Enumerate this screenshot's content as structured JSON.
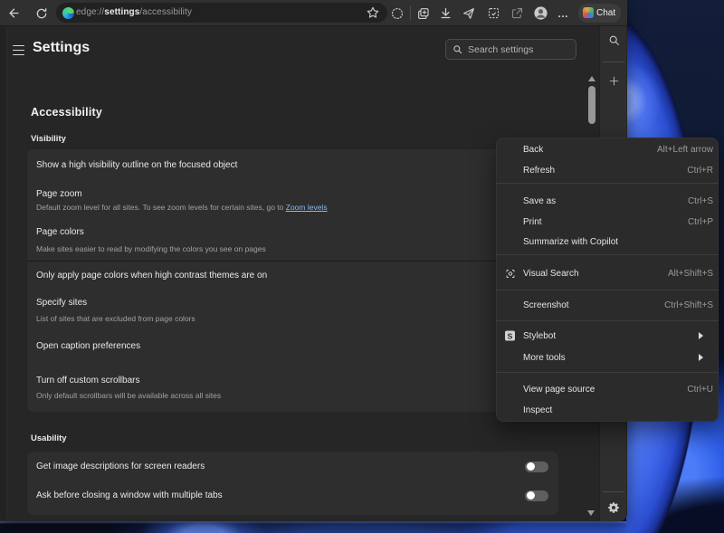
{
  "browser": {
    "url": {
      "scheme": "edge://",
      "highlight": "settings",
      "path": "/accessibility"
    },
    "toolbar_icons": [
      "back",
      "refresh",
      "favorite-star",
      "browser-essentials",
      "collections",
      "downloads",
      "send",
      "web-capture",
      "share",
      "profile-avatar",
      "more-options"
    ],
    "chat_button_label": "Chat"
  },
  "sidebar_rail_icons": [
    "search",
    "add",
    "settings-gear"
  ],
  "settings_header": {
    "title": "Settings",
    "search_placeholder": "Search settings"
  },
  "page": {
    "title": "Accessibility",
    "sections": [
      {
        "heading": "Visibility",
        "rows": [
          {
            "title": "Show a high visibility outline on the focused object"
          },
          {
            "title": "Page zoom",
            "subtitle": "Default zoom level for all sites. To see zoom levels for certain sites, go to ",
            "link": "Zoom levels"
          },
          {
            "title": "Page colors",
            "subtitle": "Make sites easier to read by modifying the colors you see on pages"
          },
          {
            "title": "Only apply page colors when high contrast themes are on"
          },
          {
            "title": "Specify sites",
            "subtitle": "List of sites that are excluded from page colors"
          },
          {
            "title": "Open caption preferences"
          },
          {
            "title": "Turn off custom scrollbars",
            "subtitle": "Only default scrollbars will be available across all sites"
          }
        ]
      },
      {
        "heading": "Usability",
        "rows": [
          {
            "title": "Get image descriptions for screen readers",
            "toggle": "off"
          },
          {
            "title": "Ask before closing a window with multiple tabs",
            "toggle": "off"
          }
        ]
      }
    ]
  },
  "context_menu": {
    "groups": [
      [
        {
          "label": "Back",
          "shortcut": "Alt+Left arrow"
        },
        {
          "label": "Refresh",
          "shortcut": "Ctrl+R"
        }
      ],
      [
        {
          "label": "Save as",
          "shortcut": "Ctrl+S"
        },
        {
          "label": "Print",
          "shortcut": "Ctrl+P"
        },
        {
          "label": "Summarize with Copilot"
        }
      ],
      [
        {
          "label": "Visual Search",
          "shortcut": "Alt+Shift+S",
          "icon": "visual-search"
        }
      ],
      [
        {
          "label": "Screenshot",
          "shortcut": "Ctrl+Shift+S"
        }
      ],
      [
        {
          "label": "Stylebot",
          "icon": "stylebot",
          "submenu": true
        },
        {
          "label": "More tools",
          "submenu": true
        }
      ],
      [
        {
          "label": "View page source",
          "shortcut": "Ctrl+U"
        },
        {
          "label": "Inspect"
        }
      ]
    ]
  },
  "colors": {
    "accent_link": "#85b8f0",
    "wallpaper_blue": "#2c52c4",
    "window_bg": "#262626",
    "card_bg": "#2e2e2e",
    "menu_bg": "#2b2b2b"
  }
}
